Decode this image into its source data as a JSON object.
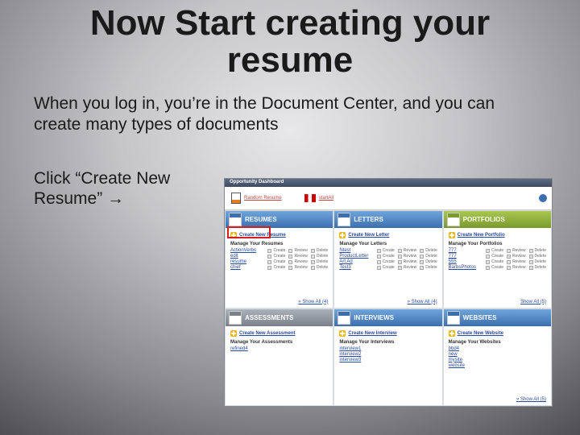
{
  "title": "Now Start creating your resume",
  "subtitle": "When you log in, you’re in the Document Center, and you can create many types of documents",
  "instruction": "Click “Create New Resume” →",
  "screenshot": {
    "header": "Opportunity Dashboard",
    "top_items": [
      "Random Resume",
      "startAll"
    ],
    "cards": [
      {
        "color": "blue",
        "title": "RESUMES",
        "create": "Create New Resume",
        "section": "Manage Your Resumes",
        "items": [
          "ActionVerbs",
          "edit",
          "resume",
          "chief"
        ],
        "ops": [
          "Create",
          "Review",
          "Delete"
        ],
        "footer": "» Show All (4)"
      },
      {
        "color": "blue",
        "title": "LETTERS",
        "create": "Create New Letter",
        "section": "Manage Your Letters",
        "items": [
          "Ntest",
          "ProductLetter",
          "Art Ad",
          "Test3"
        ],
        "ops": [
          "Create",
          "Review",
          "Delete"
        ],
        "footer": "» Show All (4)"
      },
      {
        "color": "green",
        "title": "PORTFOLIOS",
        "create": "Create New Portfolio",
        "section": "Manage Your Portfolios",
        "items": [
          "777",
          "777",
          "555",
          "BarbsPhotos"
        ],
        "ops": [
          "Create",
          "Review",
          "Delete"
        ],
        "footer": "Show All (5)"
      },
      {
        "color": "grey",
        "title": "ASSESSMENTS",
        "create": "Create New Assessment",
        "section": "Manage Your Assessments",
        "items": [
          "refined4"
        ],
        "ops": [],
        "footer": ""
      },
      {
        "color": "blue",
        "title": "INTERVIEWS",
        "create": "Create New Interview",
        "section": "Manage Your Interviews",
        "items": [
          "interview1",
          "interview2",
          "interview3"
        ],
        "ops": [],
        "footer": ""
      },
      {
        "color": "blue",
        "title": "WEBSITES",
        "create": "Create New Website",
        "section": "Manage Your Websites",
        "items": [
          "bbd4",
          "new",
          "mysite",
          "website"
        ],
        "ops": [],
        "footer": "» Show All (5)"
      }
    ]
  }
}
